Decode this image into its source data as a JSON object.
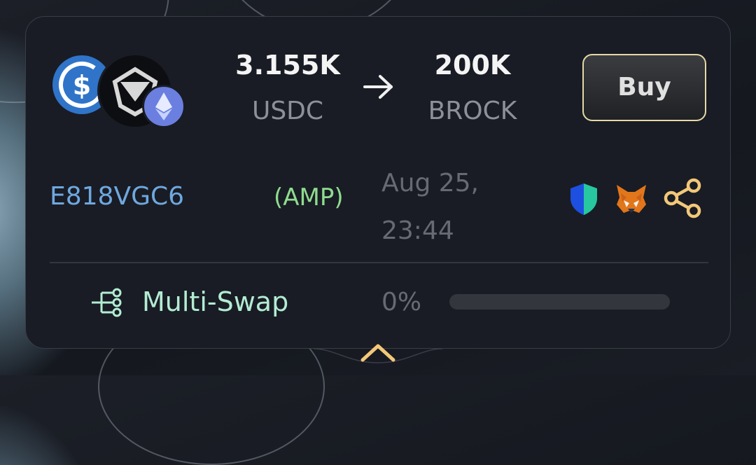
{
  "trade": {
    "pay_amount": "3.155K",
    "pay_symbol": "USDC",
    "receive_amount": "200K",
    "receive_symbol": "BROCK",
    "buy_label": "Buy"
  },
  "details": {
    "wallet_id": "E818VGC6",
    "tag": "(AMP)",
    "date_line1": "Aug 25,",
    "date_line2": "23:44"
  },
  "multiswap": {
    "label": "Multi-Swap",
    "percent_text": "0%",
    "progress": 0
  },
  "icons": {
    "pay_token": "usdc-icon",
    "receive_token": "brock-token-icon",
    "chain": "ethereum-icon",
    "security": "shield-icon",
    "wallet": "metamask-fox-icon",
    "share": "share-icon",
    "multiswap": "tree-branch-icon",
    "collapse": "chevron-up-icon"
  },
  "colors": {
    "accent": "#e6d9a6",
    "wallet_id": "#6fa8e0",
    "tag": "#8fdc8f",
    "multiswap": "#b3ecd3"
  }
}
